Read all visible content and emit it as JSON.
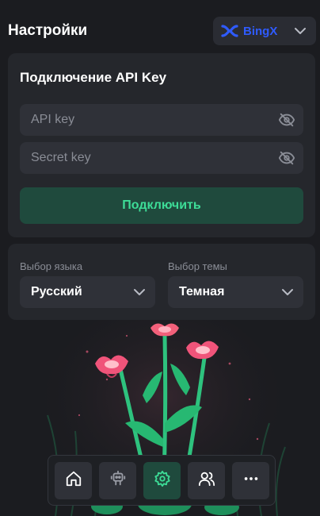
{
  "header": {
    "title": "Настройки",
    "exchange": {
      "name": "BingX",
      "logo_icon": "bingx-logo-icon",
      "dropdown_icon": "chevron-down-icon"
    }
  },
  "api_card": {
    "title": "Подключение API Key",
    "api_key": {
      "placeholder": "API key",
      "value": "",
      "toggle_icon": "eye-off-icon"
    },
    "secret_key": {
      "placeholder": "Secret key",
      "value": "",
      "toggle_icon": "eye-off-icon"
    },
    "connect_label": "Подключить"
  },
  "preferences": {
    "language": {
      "label": "Выбор языка",
      "selected": "Русский"
    },
    "theme": {
      "label": "Выбор темы",
      "selected": "Темная"
    }
  },
  "illustration": {
    "subject": "pink flowers and green leaves"
  },
  "bottom_nav": {
    "items": [
      {
        "icon": "home-icon",
        "active": false
      },
      {
        "icon": "robot-icon",
        "active": false
      },
      {
        "icon": "gear-icon",
        "active": true
      },
      {
        "icon": "users-icon",
        "active": false
      },
      {
        "icon": "more-dots-icon",
        "active": false
      }
    ]
  },
  "colors": {
    "background": "#1b1c20",
    "card": "#25272c",
    "field": "#2f3138",
    "accent_green": "#3ddc97",
    "active_green_bg": "#1f4a3d",
    "bingx_blue": "#2f5bff",
    "muted_text": "#8a8d96"
  }
}
